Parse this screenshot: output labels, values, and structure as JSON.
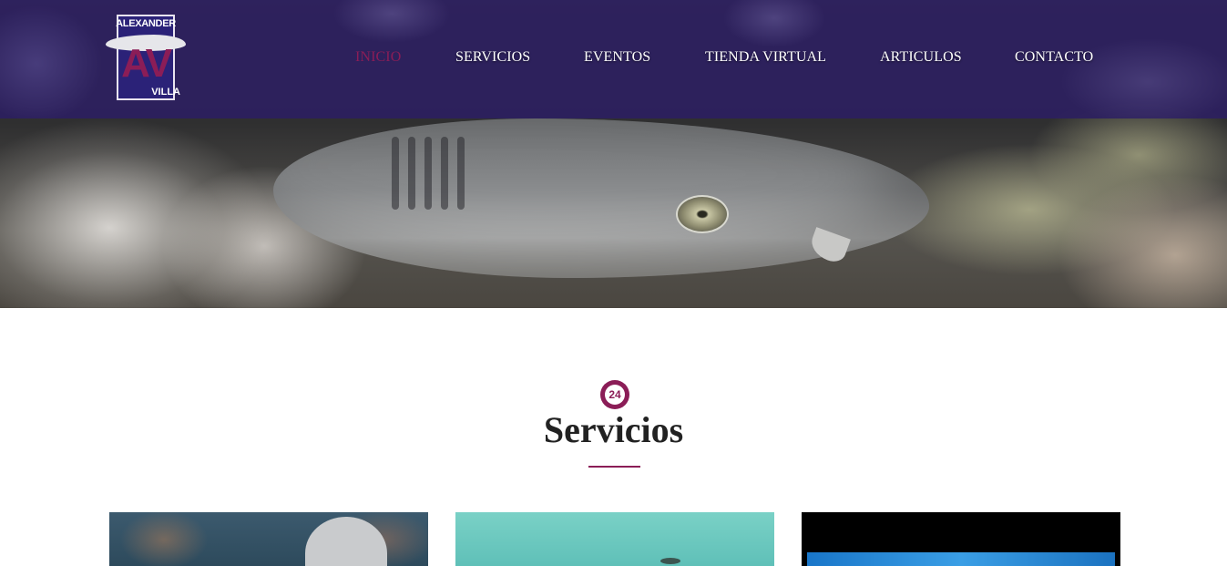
{
  "brand": {
    "logo_top": "ALEXANDER",
    "logo_letters": "AV",
    "logo_bottom": "VILLA"
  },
  "nav": {
    "items": [
      {
        "label": "INICIO",
        "active": true
      },
      {
        "label": "SERVICIOS",
        "active": false
      },
      {
        "label": "EVENTOS",
        "active": false
      },
      {
        "label": "TIENDA VIRTUAL",
        "active": false
      },
      {
        "label": "ARTICULOS",
        "active": false
      },
      {
        "label": "CONTACTO",
        "active": false
      }
    ]
  },
  "section": {
    "icon": "24-hours-icon",
    "icon_text": "24",
    "title": "Servicios"
  },
  "colors": {
    "accent": "#8b1d57",
    "header": "#2c2060"
  }
}
